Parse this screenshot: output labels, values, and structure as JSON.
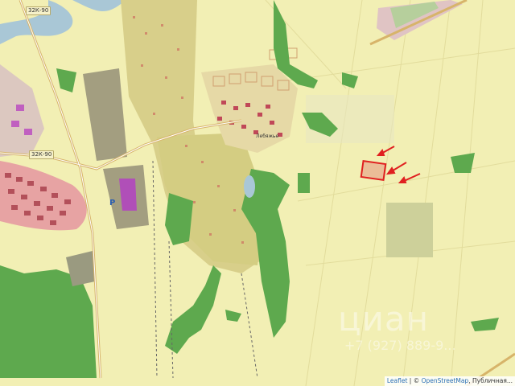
{
  "map": {
    "road_labels": [
      "32К-90",
      "32К-90"
    ],
    "parking_label": "P",
    "place_label": "Лебяжье",
    "watermark": {
      "brand": "циан",
      "phone": "+7 (927) 889-9..."
    },
    "attribution": {
      "leaflet": "Leaflet",
      "separator": " | © ",
      "osm": "OpenStreetMap",
      "suffix": ", Публичная..."
    },
    "highlight_color": "#e02020",
    "forest_color": "#5ea94e",
    "farmland_color": "#f2efb4",
    "residential_color": "#d8cf8a"
  }
}
